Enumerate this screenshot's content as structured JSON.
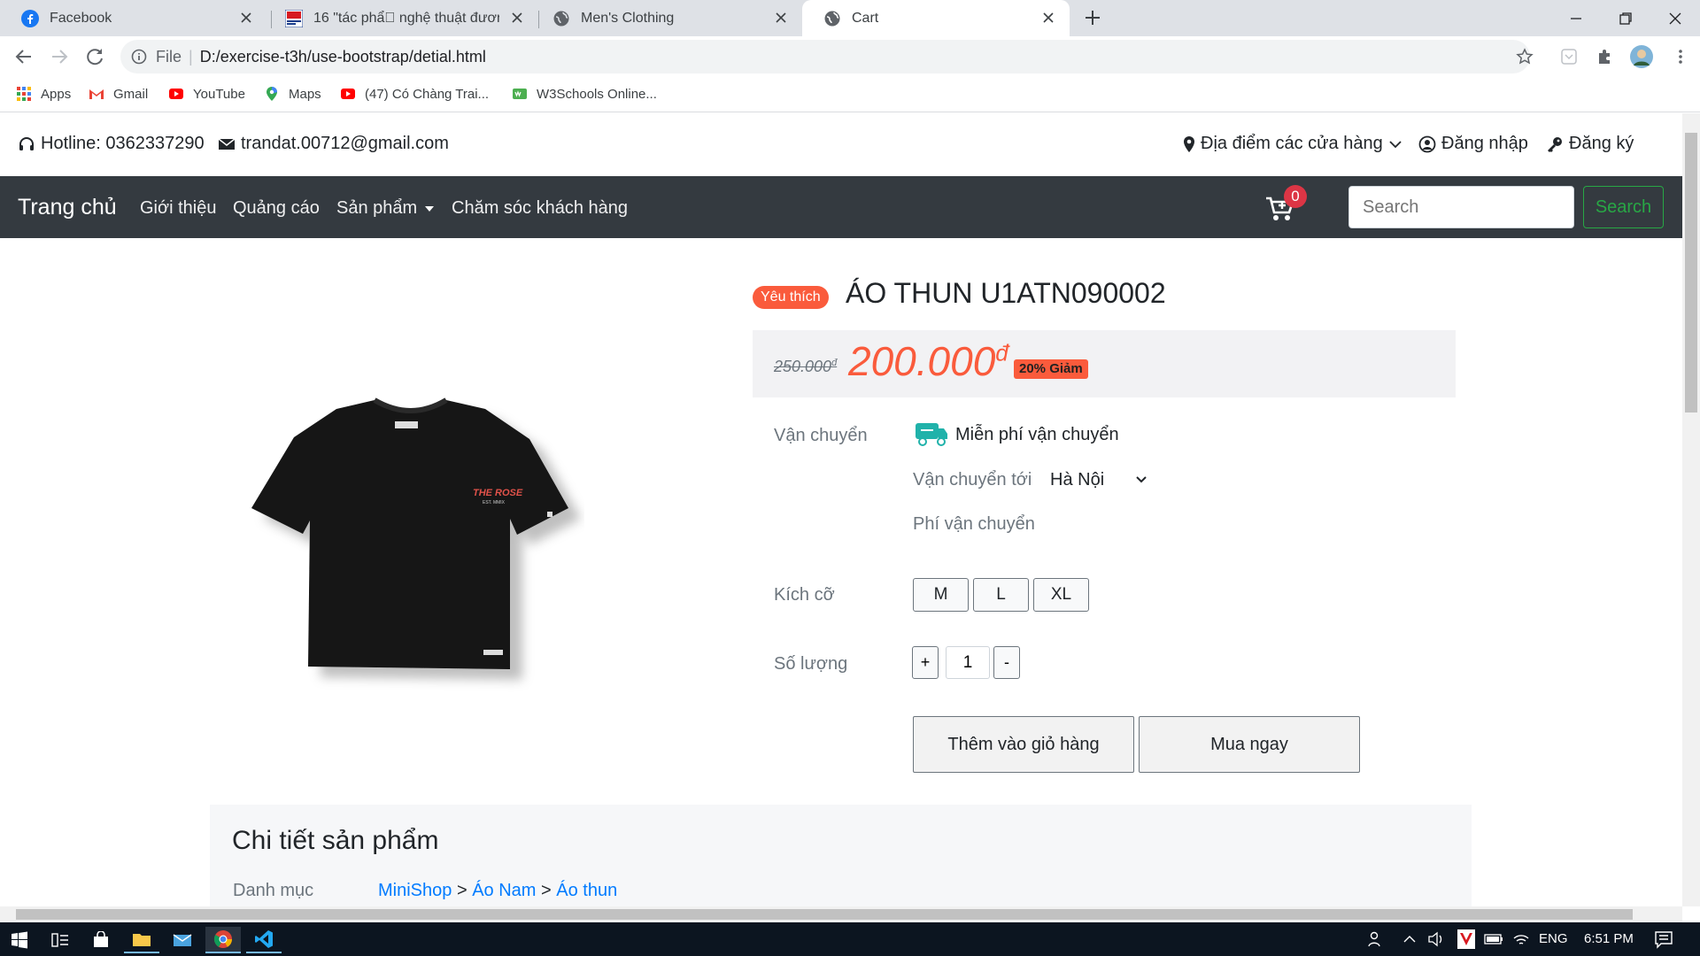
{
  "browser": {
    "tabs": [
      {
        "title": "Facebook",
        "active": false
      },
      {
        "title": "16 \"tác phẩ\u0000 nghệ thuật đương đ",
        "active": false
      },
      {
        "title": "Men's Clothing",
        "active": false
      },
      {
        "title": "Cart",
        "active": true
      }
    ],
    "address": {
      "scheme_label": "File",
      "url": "D:/exercise-t3h/use-bootstrap/detial.html"
    },
    "bookmarks": [
      {
        "label": "Apps",
        "icon": "apps-grid-icon"
      },
      {
        "label": "Gmail",
        "icon": "gmail-icon"
      },
      {
        "label": "YouTube",
        "icon": "youtube-icon"
      },
      {
        "label": "Maps",
        "icon": "maps-pin-icon"
      },
      {
        "label": "(47) Có Chàng Trai...",
        "icon": "youtube-icon"
      },
      {
        "label": "W3Schools Online...",
        "icon": "w3schools-icon"
      }
    ]
  },
  "page": {
    "topbar": {
      "hotline": "Hotline: 0362337290",
      "email": "trandat.00712@gmail.com",
      "stores": "Địa điểm các cửa hàng",
      "login": "Đăng nhập",
      "register": "Đăng ký"
    },
    "navbar": {
      "brand": "Trang chủ",
      "links": [
        "Giới thiệu",
        "Quảng cáo",
        "Sản phẩm",
        "Chăm sóc khách hàng"
      ],
      "cart_count": "0",
      "search_placeholder": "Search",
      "search_button": "Search"
    },
    "product": {
      "badge": "Yêu thích",
      "title": "ÁO THUN U1ATN090002",
      "old_price": "250.000",
      "new_price": "200.000",
      "currency": "đ",
      "discount": "20% Giảm",
      "image_text": {
        "brand": "THE ROSE",
        "sub": "EST. MMIX"
      },
      "shipping_label": "Vận chuyển",
      "free_shipping": "Miễn phí vận chuyển",
      "ship_to_label": "Vận chuyển tới",
      "ship_to_city": "Hà Nội",
      "shipping_fee_label": "Phí vận chuyển",
      "size_label": "Kích cỡ",
      "sizes": [
        "M",
        "L",
        "XL"
      ],
      "qty_label": "Số lượng",
      "qty_plus": "+",
      "qty_minus": "-",
      "qty_value": "1",
      "add_to_cart": "Thêm vào giỏ hàng",
      "buy_now": "Mua ngay"
    },
    "details": {
      "title": "Chi tiết sản phẩm",
      "category_label": "Danh mục",
      "breadcrumb": [
        "MiniShop",
        "Áo Nam",
        "Áo thun"
      ],
      "separator": ">"
    }
  },
  "taskbar": {
    "lang": "ENG",
    "time": "6:51 PM"
  },
  "colors": {
    "accent": "#fa5b3c",
    "navbar": "#343a40",
    "success": "#28a745",
    "link": "#007bff"
  }
}
